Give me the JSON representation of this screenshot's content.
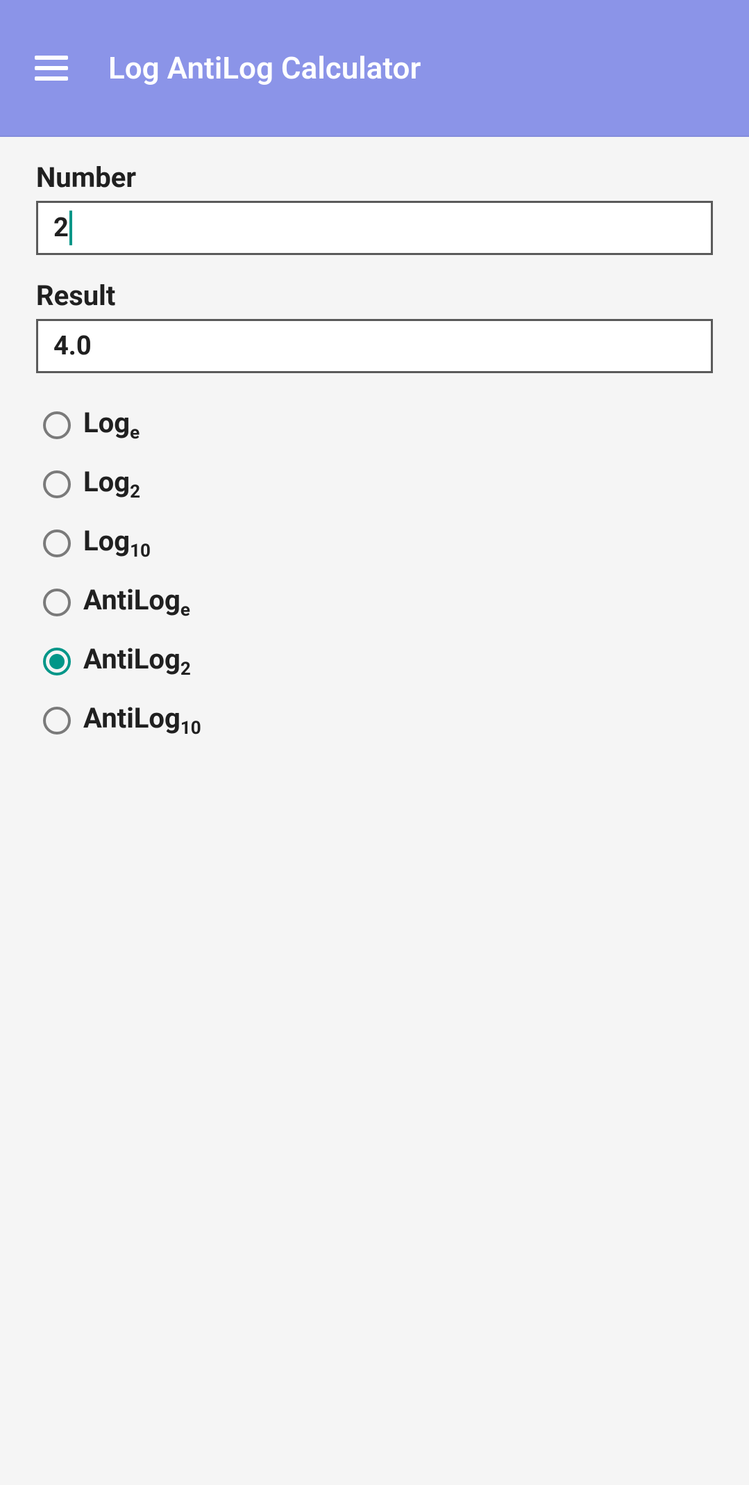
{
  "header": {
    "title": "Log AntiLog Calculator"
  },
  "fields": {
    "number_label": "Number",
    "number_value": "2",
    "result_label": "Result",
    "result_value": "4.0"
  },
  "options": [
    {
      "main": "Log",
      "sub": "e",
      "selected": false
    },
    {
      "main": "Log",
      "sub": "2",
      "selected": false
    },
    {
      "main": "Log",
      "sub": "10",
      "selected": false
    },
    {
      "main": "AntiLog",
      "sub": "e",
      "selected": false
    },
    {
      "main": "AntiLog",
      "sub": "2",
      "selected": true
    },
    {
      "main": "AntiLog",
      "sub": "10",
      "selected": false
    }
  ]
}
